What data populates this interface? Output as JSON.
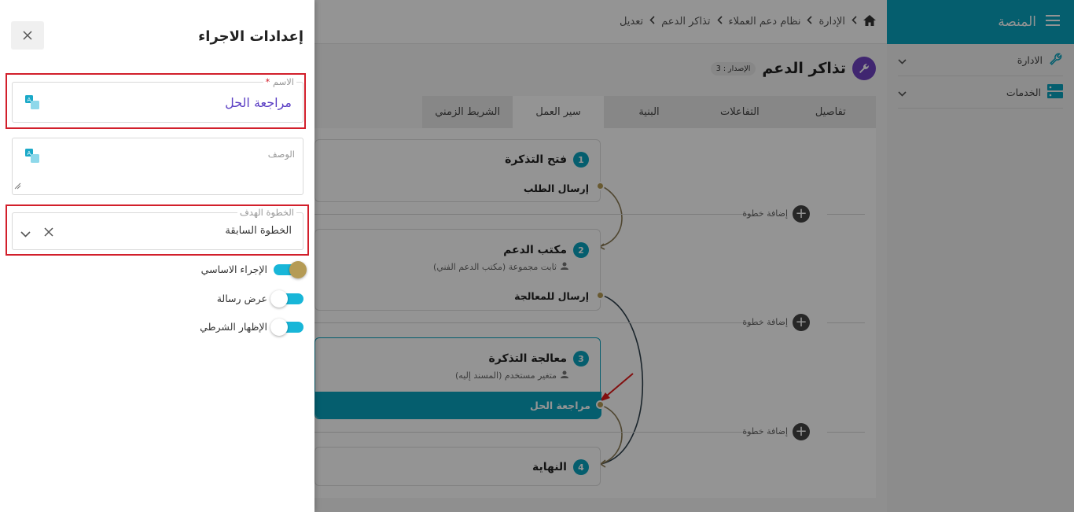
{
  "sidebar": {
    "title": "المنصة",
    "items": [
      {
        "label": "الادارة",
        "icon": "wrench-icon"
      },
      {
        "label": "الخدمات",
        "icon": "server-icon"
      }
    ]
  },
  "breadcrumb": {
    "items": [
      "الإدارة",
      "نظام دعم العملاء",
      "تذاكر الدعم",
      "تعديل"
    ]
  },
  "page": {
    "title": "تذاكر الدعم",
    "version_badge": "الإصدار : 3"
  },
  "tabs": [
    "تفاصيل",
    "التفاعلات",
    "البنية",
    "سير العمل",
    "الشريط الزمني"
  ],
  "active_tab": "سير العمل",
  "workflow": {
    "steps": [
      {
        "number": "1",
        "name": "فتح التذكرة",
        "action": "إرسال الطلب"
      },
      {
        "number": "2",
        "name": "مكتب الدعم",
        "subtitle": "ثابت مجموعة (مكتب الدعم الفني)",
        "action": "إرسال للمعالجة"
      },
      {
        "number": "3",
        "name": "معالجة التذكرة",
        "subtitle": "متغير مستخدم (المسند إليه)",
        "action": "مراجعة الحل"
      },
      {
        "number": "4",
        "name": "النهاية"
      }
    ],
    "add_step_label": "إضافة خطوة"
  },
  "drawer": {
    "title": "إعدادات الاجراء",
    "name_label": "الاسم",
    "name_required_mark": "*",
    "name_value": "مراجعة الحل",
    "description_label": "الوصف",
    "target_label": "الخطوة الهدف",
    "target_value": "الخطوة السابقة",
    "toggles": [
      {
        "label": "الإجراء الاساسي",
        "on": true
      },
      {
        "label": "عرض رسالة",
        "on": false
      },
      {
        "label": "الإظهار الشرطي",
        "on": false
      }
    ]
  },
  "colors": {
    "accent": "#0aa3bd",
    "highlight": "#d21f2b",
    "name_text": "#5b3fc4",
    "toggle_on_knob": "#b59b55"
  }
}
